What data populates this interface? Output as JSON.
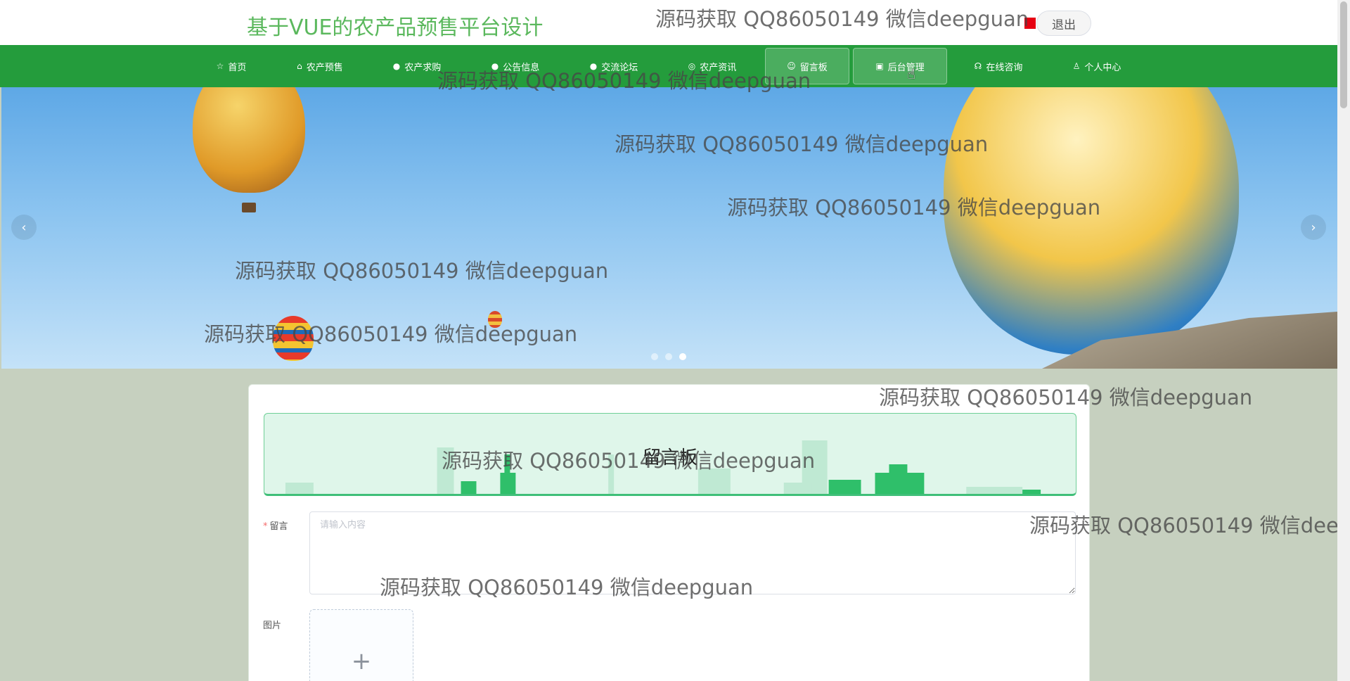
{
  "header": {
    "site_title": "基于VUE的农产品预售平台设计",
    "logout_label": "退出",
    "flag_icon": "red-square-icon"
  },
  "nav": {
    "items": [
      {
        "icon": "☆",
        "label": "首页"
      },
      {
        "icon": "⌂",
        "label": "农产预售"
      },
      {
        "icon": "●",
        "label": "农产求购"
      },
      {
        "icon": "●",
        "label": "公告信息"
      },
      {
        "icon": "●",
        "label": "交流论坛"
      },
      {
        "icon": "◎",
        "label": "农产资讯"
      },
      {
        "icon": "☺",
        "label": "留言板"
      },
      {
        "icon": "▣",
        "label": "后台管理"
      },
      {
        "icon": "☊",
        "label": "在线咨询"
      },
      {
        "icon": "♙",
        "label": "个人中心"
      }
    ],
    "active_index": 6,
    "bg_color": "#249c3c"
  },
  "carousel": {
    "prev_icon": "‹",
    "next_icon": "›",
    "slide_count": 3,
    "active_slide": 2
  },
  "board": {
    "title": "留言板",
    "message_label": "留言",
    "message_placeholder": "请输入内容",
    "image_label": "图片",
    "upload_icon": "+"
  },
  "watermark": {
    "text": "源码获取 QQ86050149 微信deepguan",
    "truncated_text": "源码获取 QQ86050149 微信deep"
  },
  "colors": {
    "accent_green": "#249c3c",
    "title_green": "#5bb85d"
  }
}
